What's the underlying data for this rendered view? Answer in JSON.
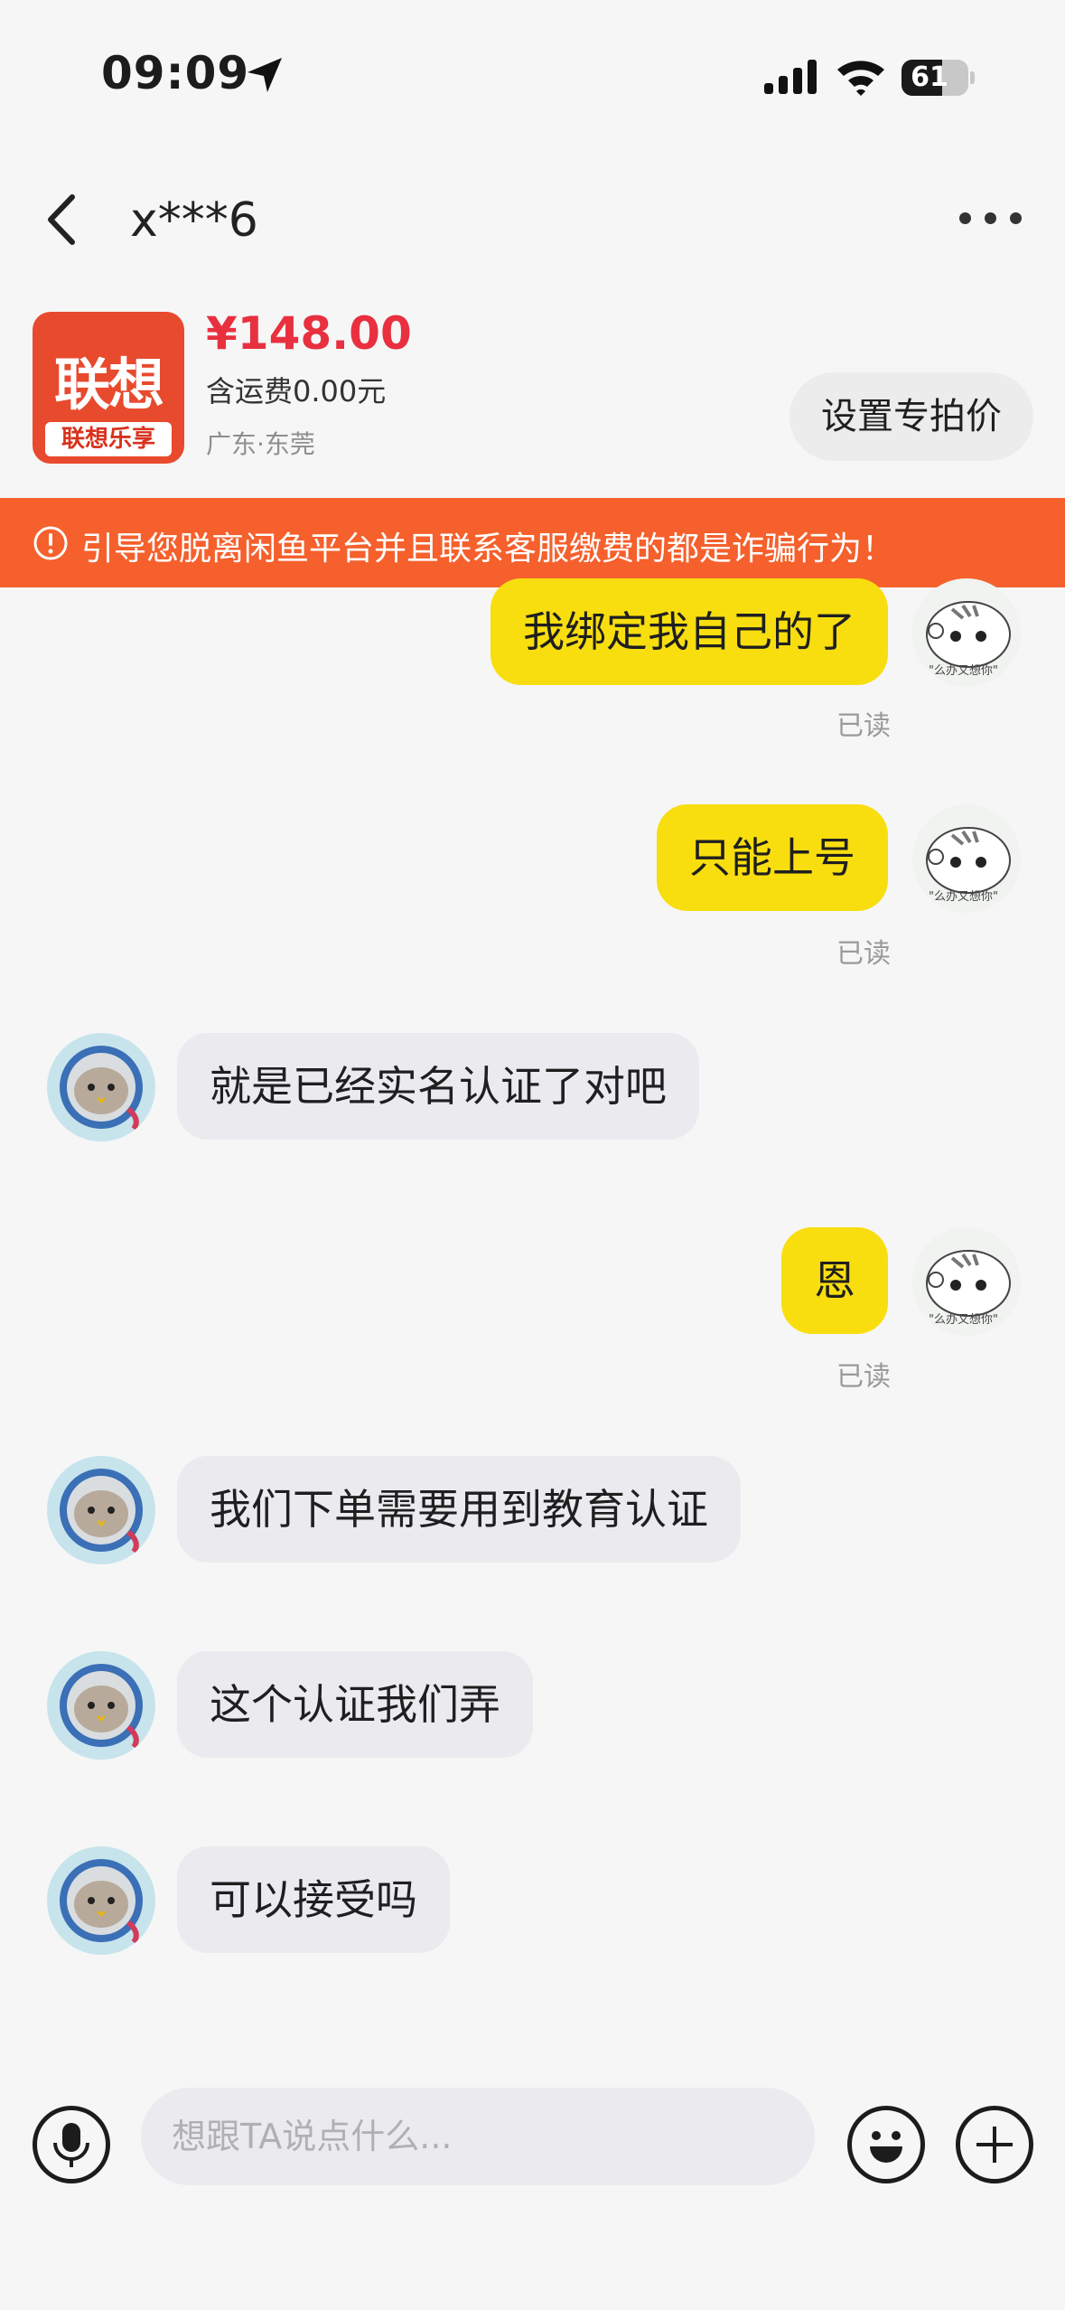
{
  "status_bar": {
    "time": "09:09",
    "battery_level": 61,
    "battery_text": "61"
  },
  "header": {
    "title": "x***6"
  },
  "product": {
    "thumb_logo": "联想",
    "thumb_sub": "联想乐享",
    "price": "¥148.00",
    "shipping": "含运费0.00元",
    "location": "广东·东莞",
    "special_price_button": "设置专拍价"
  },
  "warning": {
    "text": "引导您脱离闲鱼平台并且联系客服缴费的都是诈骗行为！"
  },
  "messages": [
    {
      "from": "me",
      "text": "我绑定我自己的了",
      "status": "已读"
    },
    {
      "from": "me",
      "text": "只能上号",
      "status": "已读"
    },
    {
      "from": "them",
      "text": "就是已经实名认证了对吧"
    },
    {
      "from": "me",
      "text": "恩",
      "status": "已读"
    },
    {
      "from": "them",
      "text": "我们下单需要用到教育认证"
    },
    {
      "from": "them",
      "text": "这个认证我们弄"
    },
    {
      "from": "them",
      "text": "可以接受吗"
    }
  ],
  "input": {
    "placeholder": "想跟TA说点什么..."
  },
  "colors": {
    "my_bubble": "#f8de0f",
    "their_bubble": "#ebebef",
    "price": "#e8303f",
    "warning_bar": "#f5602c"
  }
}
